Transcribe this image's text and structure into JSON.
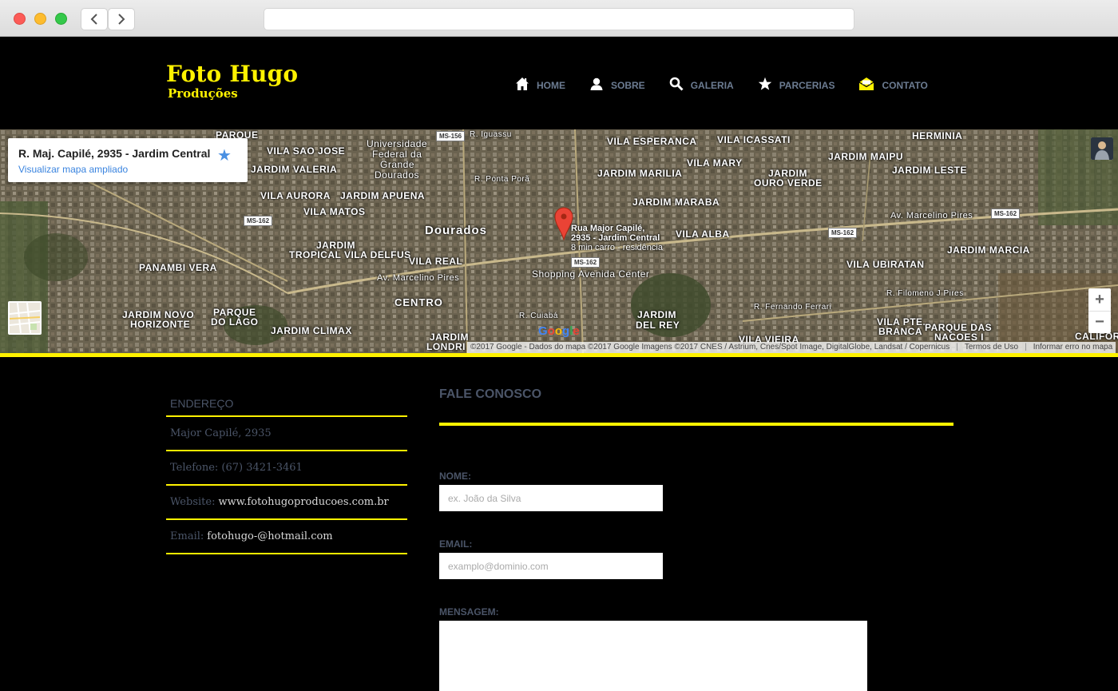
{
  "browser": {
    "url": ""
  },
  "header": {
    "logo_title": "Foto Hugo",
    "logo_subtitle": "Produções",
    "menu": [
      {
        "label": "HOME",
        "icon": "house-icon"
      },
      {
        "label": "SOBRE",
        "icon": "person-icon"
      },
      {
        "label": "GALERIA",
        "icon": "magnifier-icon"
      },
      {
        "label": "PARCERIAS",
        "icon": "star-icon"
      },
      {
        "label": "CONTATO",
        "icon": "envelope-icon"
      }
    ],
    "accent_color": "#fff200",
    "menu_color": "#6c7c92"
  },
  "map": {
    "infocard_address": "R. Maj. Capilé, 2935 - Jardim Central",
    "infocard_link": "Visualizar mapa ampliado",
    "pin_title": "Rua Major Capilé, 2935 - Jardim Central",
    "pin_title_line1": "Rua Major Capilé,",
    "pin_title_line2": "2935 - Jardim Central",
    "pin_subtitle": "8 min carro - residência",
    "zoom_in": "+",
    "zoom_out": "−",
    "attribution": "©2017 Google - Dados do mapa ©2017 Google Imagens ©2017 CNES / Astrium, Cnes/Spot Image, DigitalGlobe, Landsat / Copernicus",
    "terms": "Termos de Uso",
    "report": "Informar erro no mapa",
    "google_logo": "Google",
    "labels": {
      "parque": "PARQUE",
      "vila_sao_jose": "VILA SAO JOSE",
      "universidade": "Universidade",
      "federal_da": "Federal da",
      "grande": "Grande",
      "dourados_uni": "Dourados",
      "r_iguassu": "R. Iguassu",
      "vila_esperanca": "VILA ESPERANCA",
      "vila_icassati": "VILA ICASSATI",
      "herminia": "HERMINIA",
      "jardim_valeria": "JARDIM VALERIA",
      "jardim_maipu": "JARDIM MAIPU",
      "vila_mary": "VILA MARY",
      "jardim_marilia": "JARDIM MARILIA",
      "jardim_leste": "JARDIM LESTE",
      "jardim": "JARDIM",
      "ouro_verde": "OURO VERDE",
      "r_ponta_pora": "R. Ponta Porã",
      "vila_aurora": "VILA AURORA",
      "jardim_apuena": "JARDIM APUENA",
      "jardim_maraba": "JARDIM MARABA",
      "vila_matos": "VILA MATOS",
      "dourados": "Dourados",
      "av_marcelino_pires": "Av. Marcelino Pires",
      "vila_alba": "VILA ALBA",
      "jardim_tropical": "JARDIM",
      "tropical_vila_delfus": "TROPICAL VILA DELFUS",
      "vila_real": "VILA REAL",
      "panambi_vera": "PANAMBI VERA",
      "vila_ubiratan": "VILA UBIRATAN",
      "jardim_marcia": "JARDIM MARCIA",
      "shopping": "Shopping Avenida Center",
      "centro": "CENTRO",
      "r_filomeno": "R. Filomeno J Pires",
      "jardim_novo": "JARDIM NOVO",
      "horizonte": "HORIZONTE",
      "parque_do_lago_1": "PARQUE",
      "parque_do_lago_2": "DO LAGO",
      "r_cuiaba": "R. Cuiabá",
      "jardim_del_rey_1": "JARDIM",
      "jardim_del_rey_2": "DEL REY",
      "r_fernando_ferrari": "R. Fernando Ferrari",
      "vila_pte_1": "VILA PTE.",
      "vila_pte_2": "BRANCA",
      "parque_das_nacoes_1": "PARQUE DAS",
      "parque_das_nacoes_2": "NACOES I",
      "jardim_climax": "JARDIM CLIMAX",
      "jardim_londrina": "JARDIM",
      "londrina": "LONDRI",
      "vila_vieira": "VILA VIEIRA",
      "california": "CALIFORNI",
      "ms156": "MS-156",
      "ms162": "MS-162"
    }
  },
  "info": {
    "heading": "ENDEREÇO",
    "address": "Major Capilé, 2935",
    "phone": "Telefone: (67) 3421-3461",
    "website_label": "Website:",
    "website_value": "www.fotohugoproducoes.com.br",
    "email_label": "Email:",
    "email_value": "fotohugo-@hotmail.com"
  },
  "contact": {
    "title": "FALE CONOSCO",
    "name_label": "NOME:",
    "name_placeholder": "ex. João da Silva",
    "email_label": "EMAIL:",
    "email_placeholder": "examplo@dominio.com",
    "message_label": "MENSAGEM:"
  }
}
